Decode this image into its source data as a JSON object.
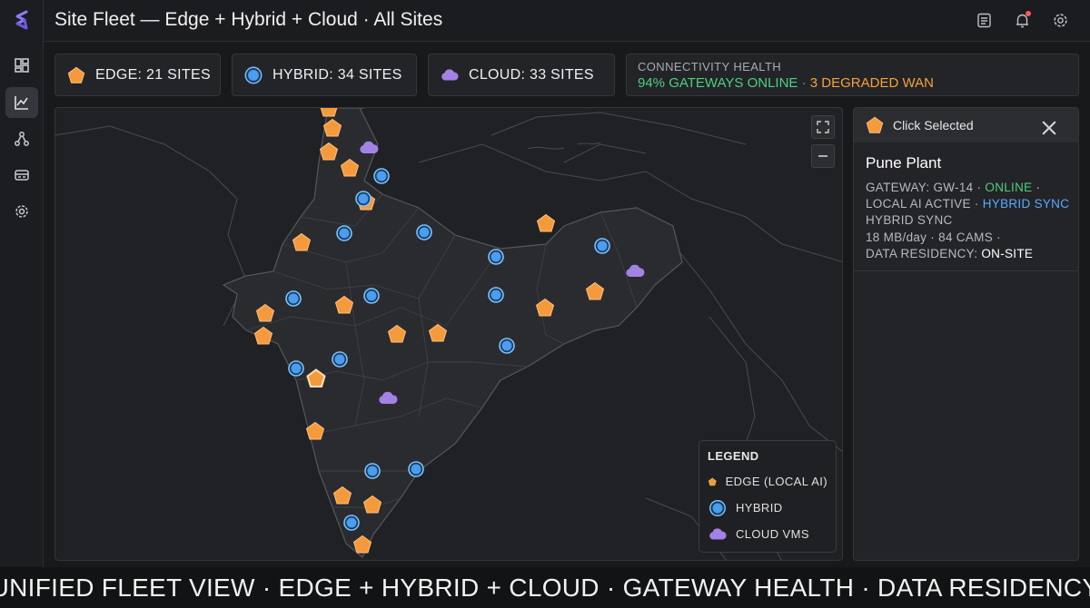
{
  "header": {
    "title": "Site Fleet — Edge + Hybrid + Cloud · All Sites",
    "icons": [
      "notes-icon",
      "bell-icon",
      "gear-icon"
    ]
  },
  "sidebar": {
    "items": [
      {
        "icon": "dashboard-icon"
      },
      {
        "icon": "chart-icon",
        "active": true
      },
      {
        "icon": "network-icon"
      },
      {
        "icon": "devices-icon"
      },
      {
        "icon": "settings-icon"
      }
    ]
  },
  "stats": {
    "edge": "EDGE: 21 SITES",
    "hybrid": "HYBRID: 34 SITES",
    "cloud": "CLOUD: 33 SITES"
  },
  "health": {
    "title": "CONNECTIVITY HEALTH",
    "online": "94% GATEWAYS ONLINE",
    "separator": "·",
    "degraded": "3 DEGRADED WAN"
  },
  "legend": {
    "title": "LEGEND",
    "edge": "EDGE (LOCAL AI)",
    "hybrid": "HYBRID",
    "cloud": "CLOUD VMS"
  },
  "panel": {
    "header": "Click Selected",
    "site_name": "Pune Plant",
    "gateway_label": "GATEWAY: GW-14 ·",
    "gateway_status": "ONLINE",
    "gateway_tail": "·",
    "ai_label": "LOCAL AI ACTIVE ·",
    "ai_mode": "HYBRID SYNC",
    "sync_line": "HYBRID SYNC",
    "usage_line": "18 MB/day · 84 CAMS ·",
    "residency_label": "DATA RESIDENCY:",
    "residency_value": "ON-SITE"
  },
  "footer": {
    "text": "UNIFIED FLEET VIEW · EDGE + HYBRID + CLOUD · GATEWAY HEALTH · DATA RESIDENCY"
  },
  "colors": {
    "edge": "#f59a3c",
    "hybrid": "#4a9df0",
    "cloud": "#a382e6",
    "online": "#4cd07d",
    "degraded": "#f5a13a"
  }
}
